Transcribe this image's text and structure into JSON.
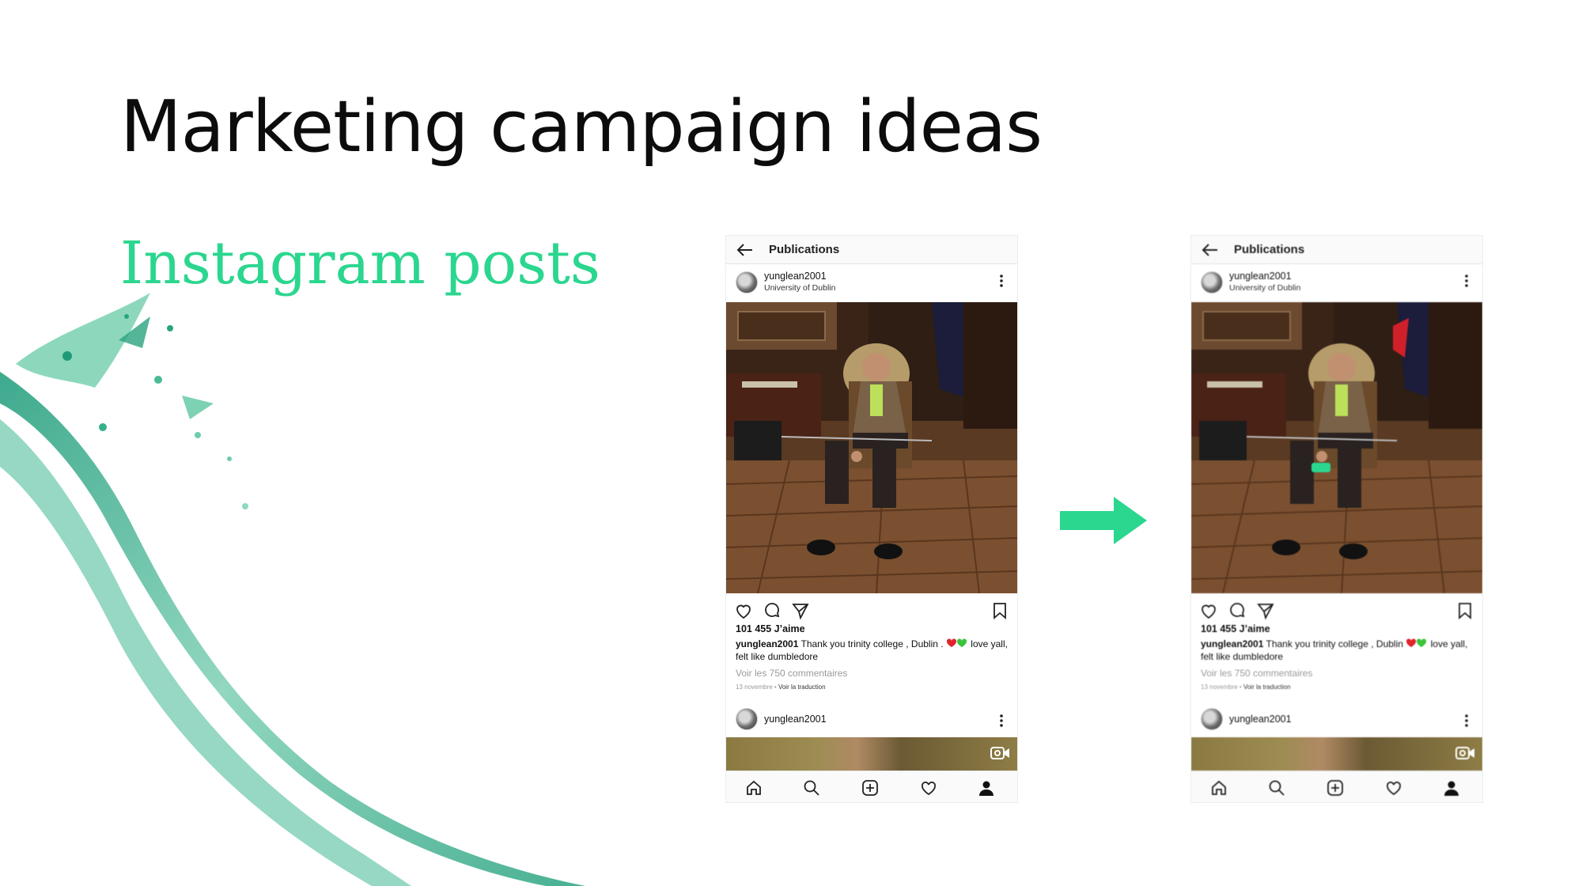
{
  "slide": {
    "title": "Marketing campaign ideas",
    "subtitle": "Instagram posts"
  },
  "colors": {
    "accent": "#2bd68f",
    "title": "#0c0c0c"
  },
  "phones": [
    {
      "topbar_title": "Publications",
      "username": "yunglean2001",
      "location": "University of Dublin",
      "likes": "101 455 J’aime",
      "caption_user": "yunglean2001",
      "caption_text": "Thank you trinity college , Dublin .",
      "caption_text2": "love yall, felt like dumbledore",
      "comments_link": "Voir les 750 commentaires",
      "date": "13 novembre",
      "separator": " • ",
      "translate": "Voir la traduction",
      "post2_username": "yunglean2001"
    },
    {
      "topbar_title": "Publications",
      "username": "yunglean2001",
      "location": "University of Dublin",
      "likes": "101 455 J’aime",
      "caption_user": "yunglean2001",
      "caption_text": "Thank you trinity college , Dublin",
      "caption_text2": "love yall, felt like dumbledore",
      "comments_link": "Voir les 750 commentaires",
      "date": "13 novembre",
      "separator": " • ",
      "translate": "Voir la traduction",
      "post2_username": "yunglean2001"
    }
  ],
  "icons": [
    "back-arrow-icon",
    "more-vertical-icon",
    "heart-icon",
    "comment-icon",
    "share-icon",
    "bookmark-icon",
    "video-icon",
    "home-icon",
    "search-icon",
    "add-icon",
    "activity-heart-icon",
    "profile-icon",
    "right-arrow-icon"
  ]
}
